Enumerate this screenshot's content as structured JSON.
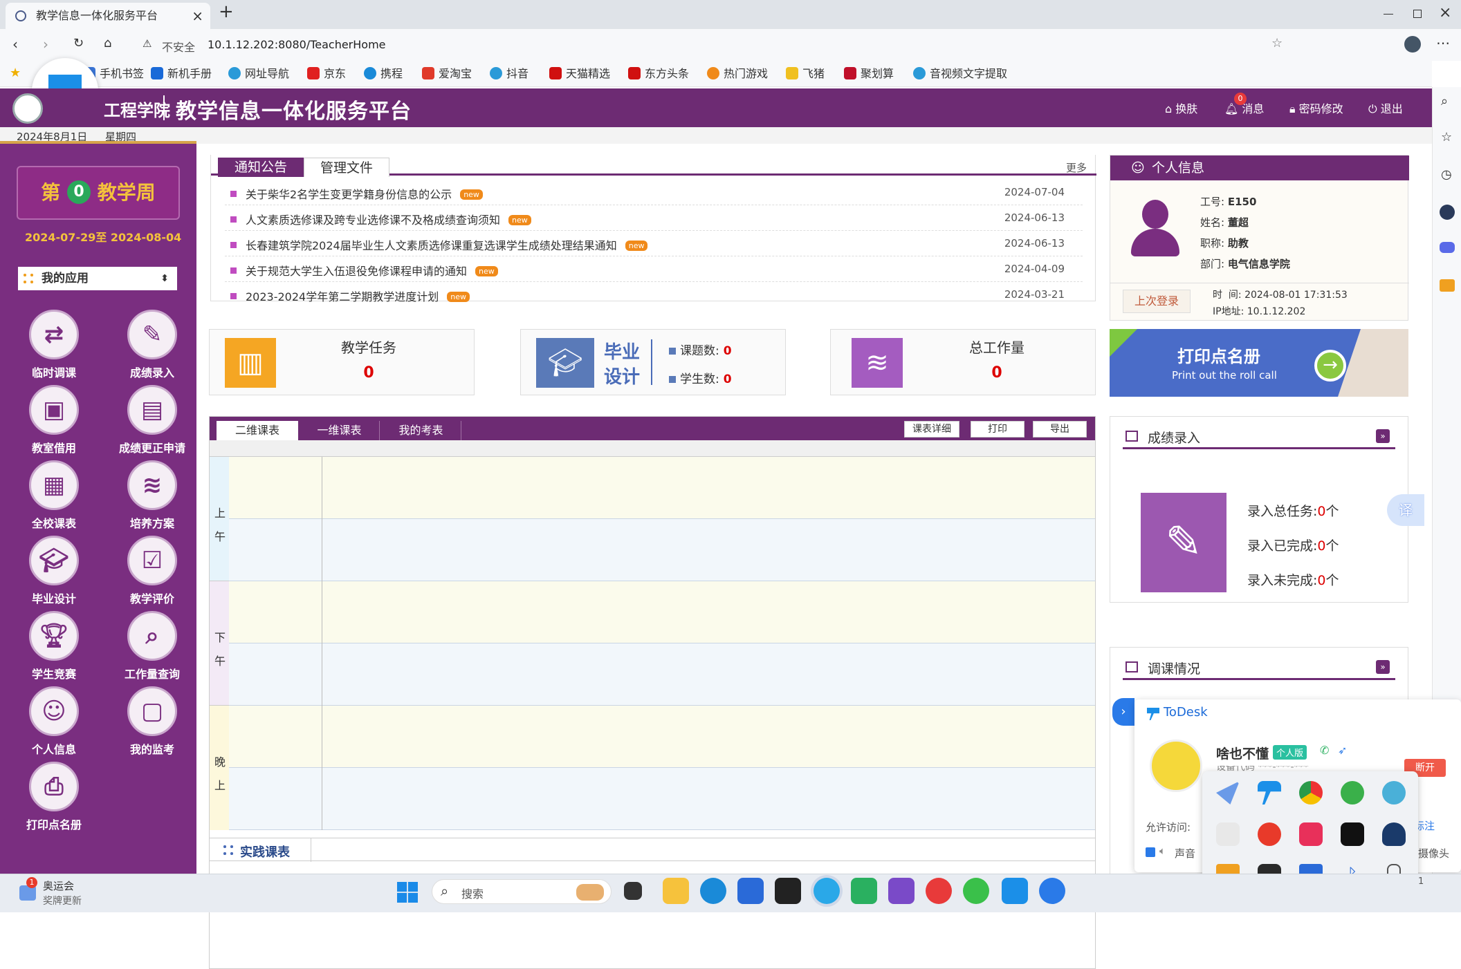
{
  "browser": {
    "tab_title": "教学信息一体化服务平台",
    "close": "×",
    "new_tab": "+",
    "insecure": "不安全",
    "url": "10.1.12.202:8080/TeacherHome"
  },
  "bookmarks": [
    "手机书签",
    "新机手册",
    "网址导航",
    "京东",
    "携程",
    "爱淘宝",
    "抖音",
    "天猫精选",
    "东方头条",
    "热门游戏",
    "飞猪",
    "聚划算",
    "音视频文字提取"
  ],
  "header": {
    "logo_text": "工程学院",
    "title": "教学信息一体化服务平台",
    "skin": "换肤",
    "msg": "消息",
    "msg_count": "0",
    "pwd": "密码修改",
    "logout": "退出"
  },
  "datebar": {
    "date": "2024年8月1日",
    "weekday": "星期四"
  },
  "sidebar": {
    "week_prefix": "第",
    "week_num": "0",
    "week_suffix": "教学周",
    "range": "2024-07-29至 2024-08-04",
    "my_apps": "我的应用",
    "apps": [
      "临时调课",
      "成绩录入",
      "教室借用",
      "成绩更正申请",
      "全校课表",
      "培养方案",
      "毕业设计",
      "教学评价",
      "学生竞赛",
      "工作量查询",
      "个人信息",
      "我的监考",
      "打印点名册"
    ]
  },
  "notices": {
    "tab1": "通知公告",
    "tab2": "管理文件",
    "more": "更多",
    "new": "new",
    "items": [
      {
        "title": "关于柴华2名学生变更学籍身份信息的公示",
        "date": "2024-07-04"
      },
      {
        "title": "人文素质选修课及跨专业选修课不及格成绩查询须知",
        "date": "2024-06-13"
      },
      {
        "title": "长春建筑学院2024届毕业生人文素质选修课重复选课学生成绩处理结果通知",
        "date": "2024-06-13"
      },
      {
        "title": "关于规范大学生入伍退役免修课程申请的通知",
        "date": "2024-04-09"
      },
      {
        "title": "2023-2024学年第二学期教学进度计划",
        "date": "2024-03-21"
      }
    ]
  },
  "stats": {
    "task_label": "教学任务",
    "task_value": "0",
    "grad_label1": "毕业",
    "grad_label2": "设计",
    "topics_label": "课题数:",
    "topics": "0",
    "students_label": "学生数:",
    "students": "0",
    "work_label": "总工作量",
    "work_value": "0"
  },
  "schedule": {
    "tab1": "二维课表",
    "tab2": "一维课表",
    "tab3": "我的考表",
    "btn1": "课表详细",
    "btn2": "打印",
    "btn3": "导出",
    "rows": [
      "上",
      "午",
      "下",
      "午",
      "晚",
      "上"
    ],
    "practice": "实践课表"
  },
  "profile": {
    "title": "个人信息",
    "id_label": "工号:",
    "id": "E150",
    "name_label": "姓名:",
    "name": "董超",
    "title_label": "职称:",
    "rank": "助教",
    "dept_label": "部门:",
    "dept": "电气信息学院",
    "last_login": "上次登录",
    "time_label": "时  间:",
    "time": "2024-08-01 17:31:53",
    "ip_label": "IP地址:",
    "ip": "10.1.12.202"
  },
  "print_banner": {
    "title": "打印点名册",
    "subtitle": "Print out the roll call"
  },
  "grades": {
    "title": "成绩录入",
    "total": "录入总任务:",
    "total_v": "0",
    "total_u": "个",
    "done": "录入已完成:",
    "done_v": "0",
    "done_u": "个",
    "undone": "录入未完成:",
    "undone_v": "0",
    "undone_u": "个",
    "translate": "译"
  },
  "adjust": {
    "title": "调课情况"
  },
  "todesk": {
    "brand": "ToDesk",
    "user": "啥也不懂",
    "edition": "个人版",
    "masked": "设备代码 ***-***-***",
    "disconnect": "断开",
    "allow": "允许访问:",
    "sound": "声音",
    "mark": "标注",
    "camera": "摄像头"
  },
  "taskbar": {
    "news_title": "奥运会",
    "news_sub": "奖牌更新",
    "news_badge": "1",
    "search": "搜索",
    "tray": "1"
  },
  "colors": {
    "purple": "#6d2b73",
    "sidebar": "#7a2e80",
    "accent": "#d6a44a",
    "banner": "#4a6cc8"
  }
}
